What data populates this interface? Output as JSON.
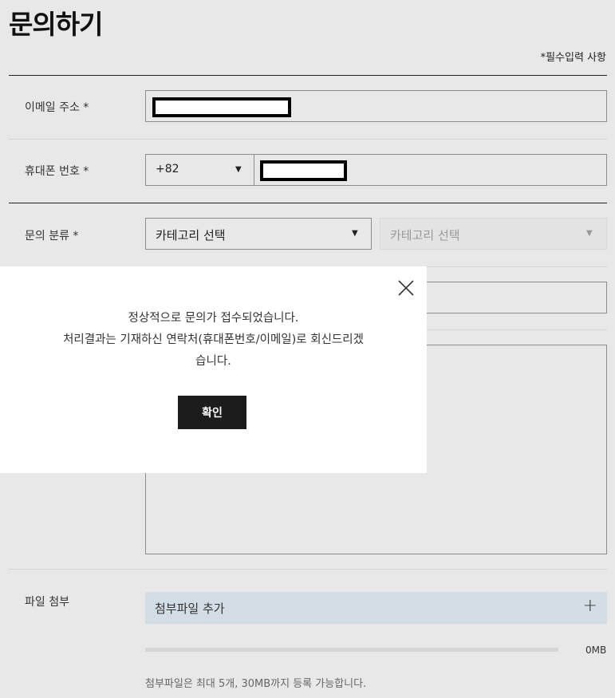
{
  "page": {
    "title": "문의하기",
    "required_note": "*필수입력 사항"
  },
  "form": {
    "email": {
      "label": "이메일 주소 *",
      "value": ""
    },
    "phone": {
      "label": "휴대폰 번호 *",
      "country_code": "+82",
      "value": ""
    },
    "category": {
      "label": "문의 분류 *",
      "primary_placeholder": "카테고리 선택",
      "secondary_placeholder": "카테고리 선택"
    },
    "attachment": {
      "label": "파일 첨부",
      "add_button_label": "첨부파일 추가",
      "add_icon": "+",
      "size_text": "0MB",
      "progress_fraction": 0,
      "help_text": "첨부파일은 최대 5개, 30MB까지 등록 가능합니다."
    }
  },
  "modal": {
    "line1": "정상적으로 문의가 접수되었습니다.",
    "line2": "처리결과는 기재하신 연락처(휴대폰번호/이메일)로 회신드리겠",
    "line3": "습니다.",
    "confirm_label": "확인",
    "close_icon": "close-icon"
  },
  "colors": {
    "background": "#e8e8e8",
    "attach_bar": "#d3dde6",
    "button": "#1c1c1c"
  }
}
